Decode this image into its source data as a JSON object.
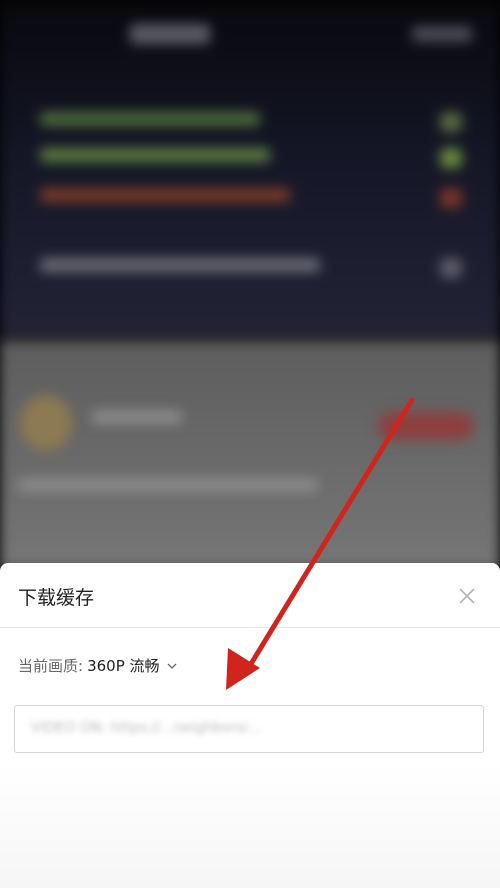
{
  "sheet": {
    "title": "下载缓存",
    "quality_label": "当前画质: ",
    "quality_value": "360P 流畅",
    "input_value": "VIDEO ON: https://...neighbors/..."
  },
  "colors": {
    "arrow": "#d0241c",
    "sheet_bg": "#ffffff"
  },
  "icons": {
    "close": "close-icon",
    "chevron": "chevron-down-icon"
  }
}
